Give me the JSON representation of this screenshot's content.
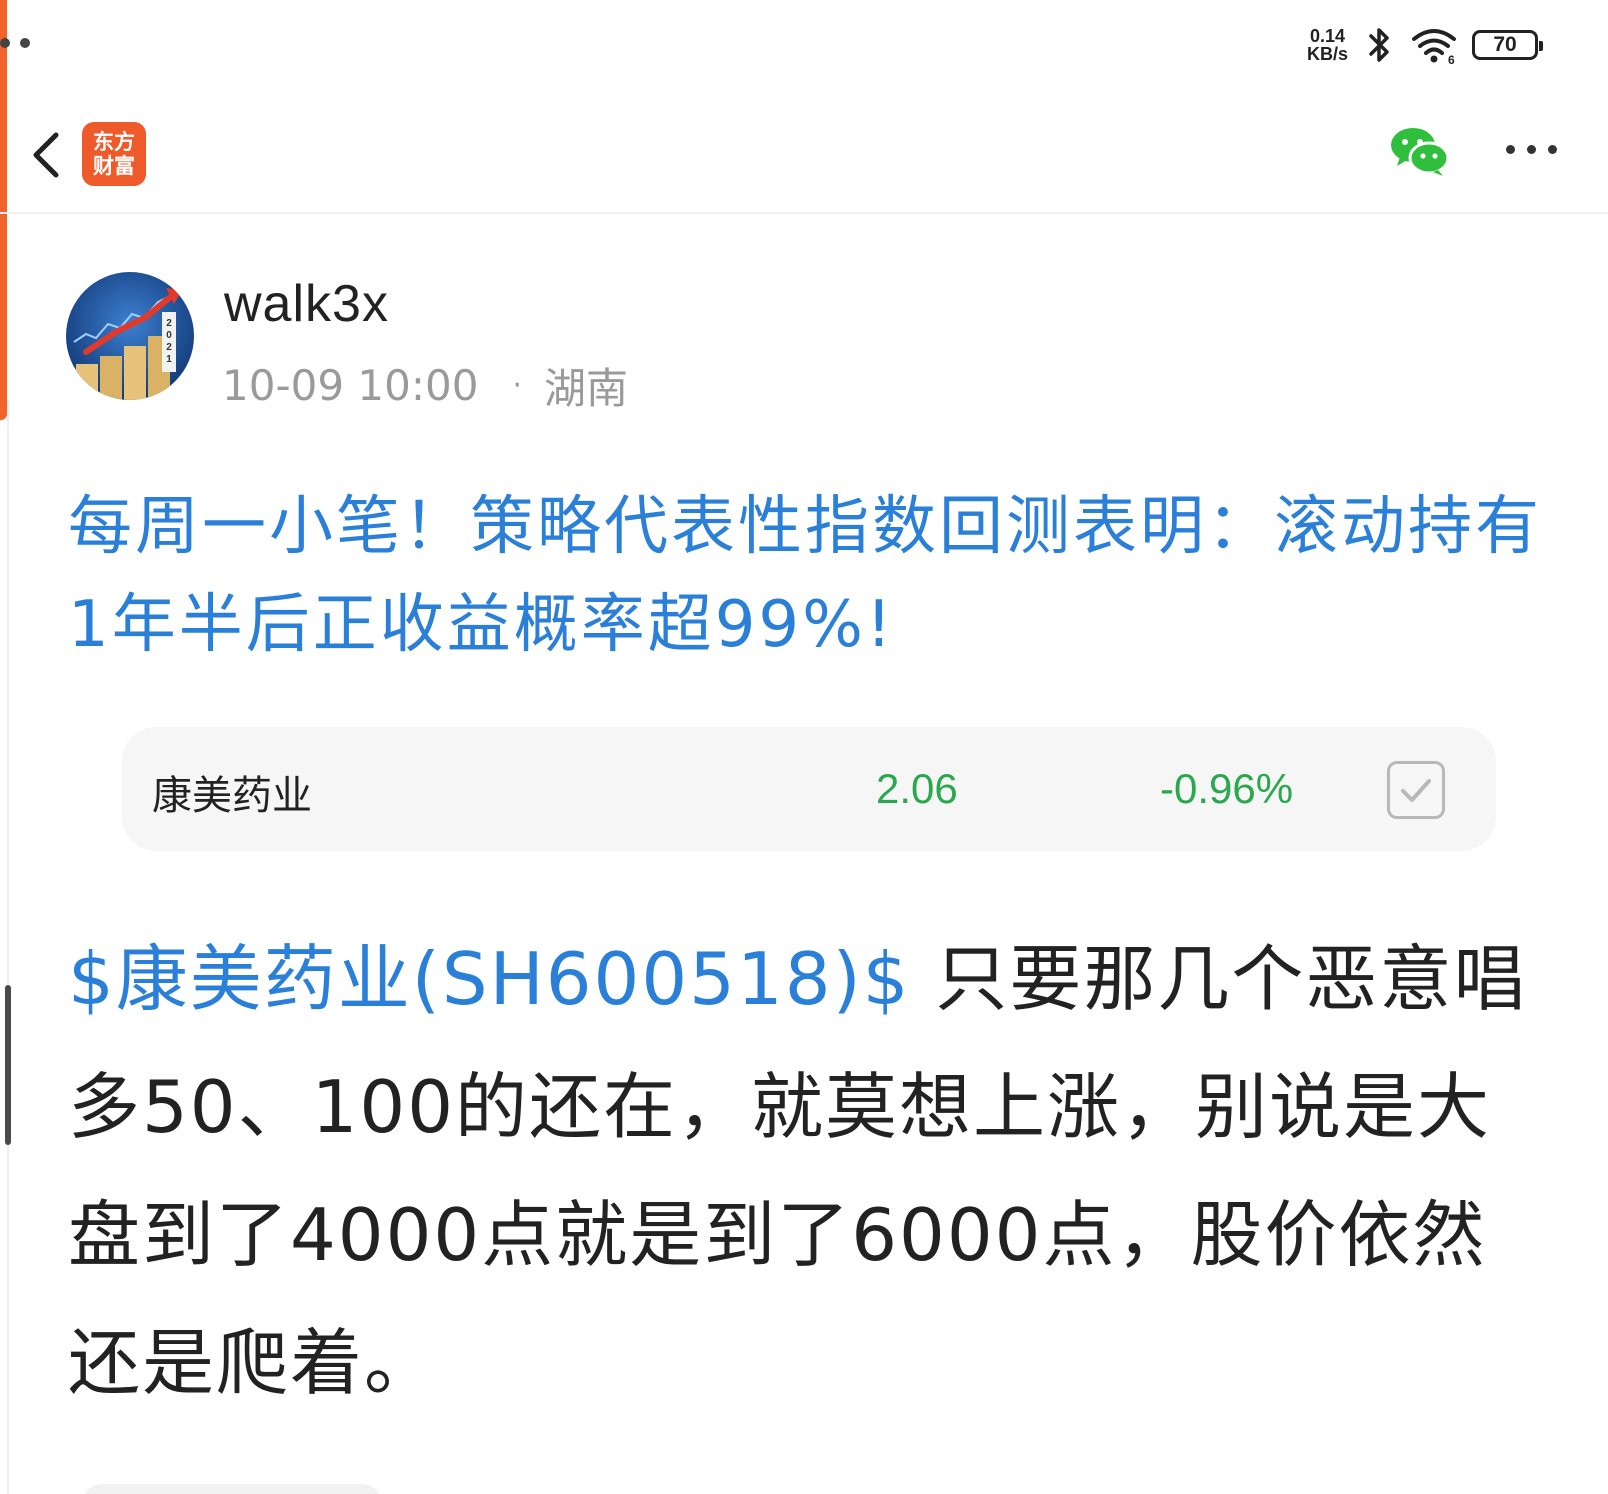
{
  "status_bar": {
    "net_speed_value": "0.14",
    "net_speed_unit": "KB/s",
    "battery": "70"
  },
  "header": {
    "brand_line1": "东方",
    "brand_line2": "财富"
  },
  "author": {
    "name": "walk3x",
    "datetime": "10-09 10:00",
    "separator": "·",
    "location": "湖南"
  },
  "post": {
    "title": "每周一小笔！策略代表性指数回测表明：滚动持有1年半后正收益概率超99%!",
    "stock_link": "$康美药业(SH600518)$",
    "body_text": "只要那几个恶意唱多50、100的还在，就莫想上涨，别说是大盘到了4000点就是到了6000点，股价依然还是爬着。"
  },
  "stock_card": {
    "name": "康美药业",
    "price": "2.06",
    "change": "-0.96%",
    "color": "#2aa84e"
  },
  "colors": {
    "accent_blue": "#2a7fd8",
    "brand_orange": "#ef5a2a",
    "wechat_green": "#2fbf3c"
  }
}
